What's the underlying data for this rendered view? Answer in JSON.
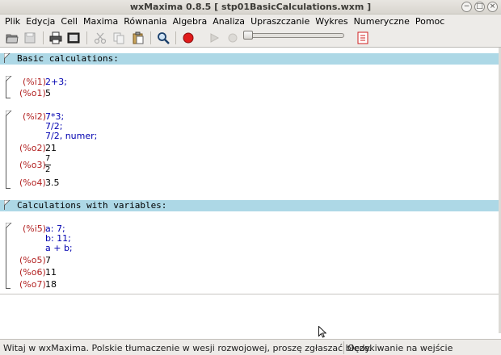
{
  "window": {
    "title": "wxMaxima 0.8.5 [ stp01BasicCalculations.wxm ]",
    "controls": [
      "−",
      "□",
      "×"
    ]
  },
  "menu": [
    "Plik",
    "Edycja",
    "Cell",
    "Maxima",
    "Równania",
    "Algebra",
    "Analiza",
    "Upraszczanie",
    "Wykres",
    "Numeryczne",
    "Pomoc"
  ],
  "toolbar": {
    "icons": [
      "open-icon",
      "save-icon",
      "print-icon",
      "config-icon",
      "cut-icon",
      "copy-icon",
      "paste-icon",
      "find-icon",
      "interrupt-icon",
      "play-icon",
      "stop-icon",
      "animation-slider",
      "insert-image-icon"
    ]
  },
  "document": {
    "sections": [
      {
        "title": "Basic calculations:"
      },
      {
        "title": "Calculations with variables:"
      }
    ],
    "cells": [
      {
        "in_label": "(%i1)",
        "input": [
          "2+3;"
        ],
        "outputs": [
          {
            "label": "(%o1)",
            "value": "5"
          }
        ]
      },
      {
        "in_label": "(%i2)",
        "input": [
          "7*3;",
          "7/2;",
          "7/2, numer;"
        ],
        "outputs": [
          {
            "label": "(%o2)",
            "value": "21"
          },
          {
            "label": "(%o3)",
            "num": "7",
            "den": "2"
          },
          {
            "label": "(%o4)",
            "value": "3.5"
          }
        ]
      },
      {
        "in_label": "(%i5)",
        "input": [
          "a: 7;",
          "b: 11;",
          "a + b;"
        ],
        "outputs": [
          {
            "label": "(%o5)",
            "value": "7"
          },
          {
            "label": "(%o6)",
            "value": "11"
          },
          {
            "label": "(%o7)",
            "value": "18"
          }
        ]
      }
    ]
  },
  "status": {
    "left": "Witaj w wxMaxima. Polskie tłumaczenie w wesji rozwojowej, proszę zgłaszać błędy.",
    "right": "Oczekiwanie na wejście"
  }
}
